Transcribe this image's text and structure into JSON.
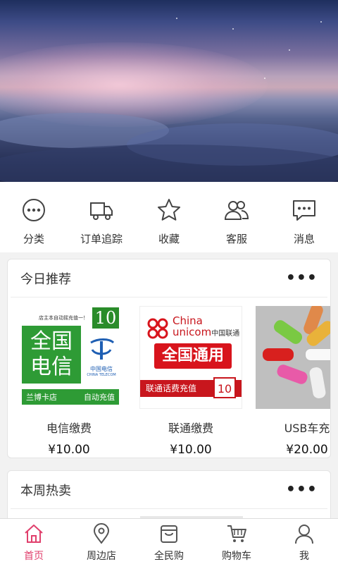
{
  "colors": {
    "accent": "#e03f6c",
    "telecom_green": "#2e9b35",
    "unicom_red": "#d8141c"
  },
  "banner": {
    "image": "sky-clouds-sunset"
  },
  "quicknav": [
    {
      "label": "分类",
      "icon": "more-circle-icon"
    },
    {
      "label": "订单追踪",
      "icon": "truck-icon"
    },
    {
      "label": "收藏",
      "icon": "star-icon"
    },
    {
      "label": "客服",
      "icon": "users-icon"
    },
    {
      "label": "消息",
      "icon": "message-icon"
    }
  ],
  "today": {
    "title": "今日推荐",
    "more": "•••",
    "products": [
      {
        "name": "电信缴费",
        "price": "¥10.00",
        "image": {
          "top_text": "店主本自动摇充值一！",
          "value": "10",
          "main_text_1": "全国",
          "main_text_2": "电信",
          "logo_cn": "中国电信",
          "logo_en": "CHINA TELECOM",
          "bar_left": "兰博卡店",
          "bar_right": "自动充值"
        }
      },
      {
        "name": "联通缴费",
        "price": "¥10.00",
        "image": {
          "brand_en_1": "China",
          "brand_en_2": "unicom",
          "brand_cn": "中国联通",
          "button": "全国通用",
          "strip": "联通话费充值",
          "value": "10"
        }
      },
      {
        "name": "USB车充",
        "price": "¥20.00",
        "image": {}
      }
    ]
  },
  "weekly": {
    "title": "本周热卖",
    "more": "•••"
  },
  "tabbar": [
    {
      "label": "首页",
      "icon": "home-icon",
      "active": true
    },
    {
      "label": "周边店",
      "icon": "location-pin-icon",
      "active": false
    },
    {
      "label": "全民购",
      "icon": "shopping-bag-icon",
      "active": false
    },
    {
      "label": "购物车",
      "icon": "cart-icon",
      "active": false
    },
    {
      "label": "我",
      "icon": "person-icon",
      "active": false
    }
  ]
}
